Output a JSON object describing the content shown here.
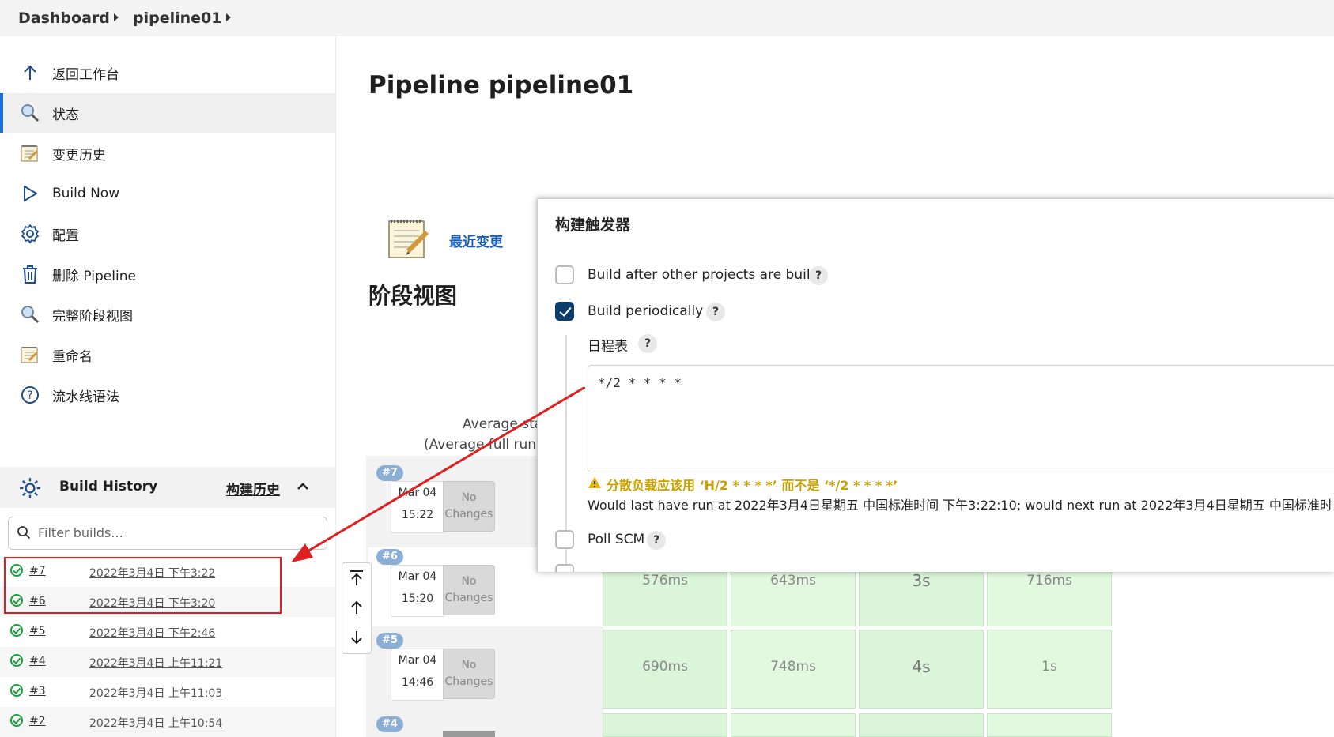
{
  "breadcrumb": {
    "home": "Dashboard",
    "job": "pipeline01"
  },
  "sidebar": {
    "items": [
      {
        "label": "返回工作台",
        "icon": "arrow-up-icon"
      },
      {
        "label": "状态",
        "icon": "magnifier-icon"
      },
      {
        "label": "变更历史",
        "icon": "notepad-icon"
      },
      {
        "label": "Build Now",
        "icon": "play-icon"
      },
      {
        "label": "配置",
        "icon": "gear-icon"
      },
      {
        "label": "删除 Pipeline",
        "icon": "trash-icon"
      },
      {
        "label": "完整阶段视图",
        "icon": "magnifier-icon"
      },
      {
        "label": "重命名",
        "icon": "notepad-icon"
      },
      {
        "label": "流水线语法",
        "icon": "help-circle-icon"
      }
    ]
  },
  "build_history": {
    "title": "Build History",
    "link": "构建历史",
    "filter_placeholder": "Filter builds...",
    "builds": [
      {
        "num": "#7",
        "date": "2022年3月4日 下午3:22"
      },
      {
        "num": "#6",
        "date": "2022年3月4日 下午3:20"
      },
      {
        "num": "#5",
        "date": "2022年3月4日 下午2:46"
      },
      {
        "num": "#4",
        "date": "2022年3月4日 上午11:21"
      },
      {
        "num": "#3",
        "date": "2022年3月4日 上午11:03"
      },
      {
        "num": "#2",
        "date": "2022年3月4日 上午10:54"
      }
    ]
  },
  "main": {
    "title": "Pipeline pipeline01",
    "recent_changes": "最近变更",
    "stage_view_title": "阶段视图",
    "avg_line1": "Average stag",
    "avg_line2": "(Average full run ti"
  },
  "stage_view": {
    "runs": [
      {
        "badge": "#7",
        "date": "Mar 04",
        "time": "15:22",
        "changes": "No Changes",
        "stages": []
      },
      {
        "badge": "#6",
        "date": "Mar 04",
        "time": "15:20",
        "changes": "No Changes",
        "stages": [
          "576ms",
          "643ms",
          "3s",
          "716ms"
        ]
      },
      {
        "badge": "#5",
        "date": "Mar 04",
        "time": "14:46",
        "changes": "No Changes",
        "stages": [
          "690ms",
          "748ms",
          "4s",
          "1s"
        ]
      },
      {
        "badge": "#4"
      }
    ]
  },
  "dialog": {
    "title": "构建触发器",
    "opt_after": "Build after other projects are built",
    "opt_periodic": "Build periodically",
    "schedule_label": "日程表",
    "schedule_value": "*/2 * * * *",
    "warning": "分散负载应该用 ‘H/2 * * * *’ 而不是 ‘*/2 * * * *’",
    "info": "Would last have run at 2022年3月4日星期五 中国标准时间 下午3:22:10; would next run at 2022年3月4日星期五 中国标准时",
    "opt_poll": "Poll SCM",
    "help": "?",
    "periodic_checked": true
  },
  "colors": {
    "accent": "#1e6fd9",
    "success": "#1a9e3d",
    "highlight": "#e02020",
    "warning": "#c9a100",
    "checkbox": "#0b3d6b"
  }
}
